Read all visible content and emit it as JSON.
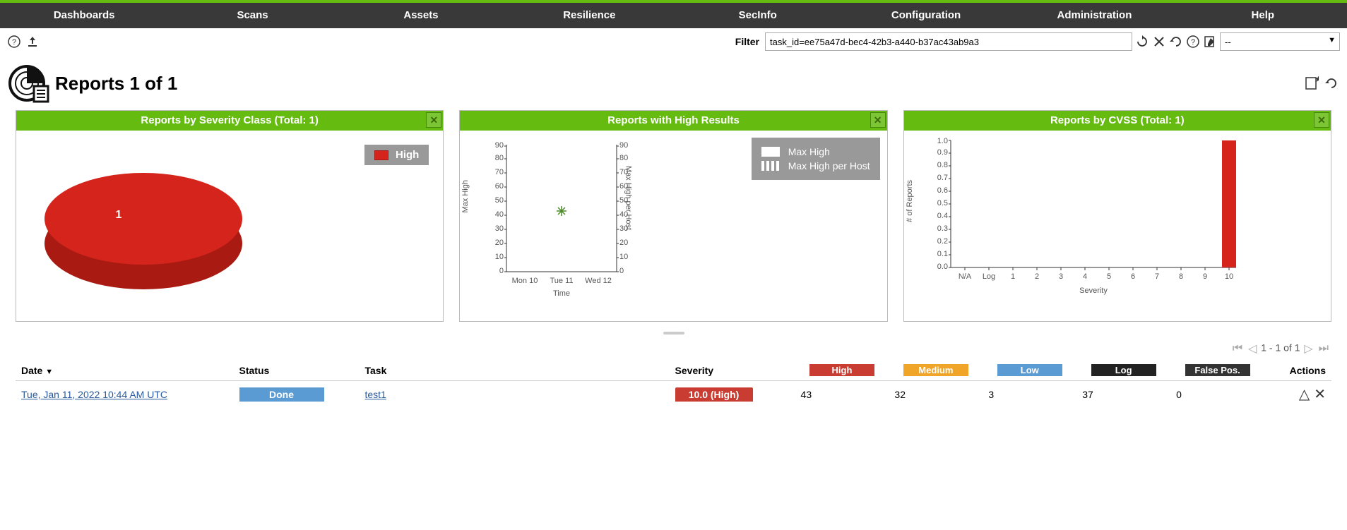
{
  "nav": [
    "Dashboards",
    "Scans",
    "Assets",
    "Resilience",
    "SecInfo",
    "Configuration",
    "Administration",
    "Help"
  ],
  "filter": {
    "label": "Filter",
    "value": "task_id=ee75a47d-bec4-42b3-a440-b37ac43ab9a3",
    "select_value": "--"
  },
  "page_title": "Reports 1 of 1",
  "panels": {
    "severity_class": {
      "title": "Reports by Severity Class (Total: 1)",
      "legend": "High",
      "slice_label": "1"
    },
    "high_results": {
      "title": "Reports with High Results",
      "legend1": "Max High",
      "legend2": "Max High per Host",
      "ylabel_left": "Max High",
      "ylabel_right": "Max High per Host",
      "xlabel": "Time"
    },
    "cvss": {
      "title": "Reports by CVSS (Total: 1)",
      "ylabel": "# of Reports",
      "xlabel": "Severity"
    }
  },
  "chart_data": [
    {
      "type": "pie",
      "title": "Reports by Severity Class (Total: 1)",
      "series": [
        {
          "name": "High",
          "value": 1,
          "color": "#d4241b"
        }
      ]
    },
    {
      "type": "scatter",
      "title": "Reports with High Results",
      "xlabel": "Time",
      "ylabel_left": "Max High",
      "ylabel_right": "Max High per Host",
      "x_ticks": [
        "Mon 10",
        "Tue 11",
        "Wed 12"
      ],
      "y_ticks": [
        0,
        10,
        20,
        30,
        40,
        50,
        60,
        70,
        80,
        90
      ],
      "ylim": [
        0,
        90
      ],
      "series": [
        {
          "name": "Max High",
          "style": "solid",
          "points": [
            {
              "x": "Tue 11",
              "y": 43
            }
          ]
        },
        {
          "name": "Max High per Host",
          "style": "dashed",
          "points": [
            {
              "x": "Tue 11",
              "y": 43
            }
          ]
        }
      ]
    },
    {
      "type": "bar",
      "title": "Reports by CVSS (Total: 1)",
      "xlabel": "Severity",
      "ylabel": "# of Reports",
      "categories": [
        "N/A",
        "Log",
        "1",
        "2",
        "3",
        "4",
        "5",
        "6",
        "7",
        "8",
        "9",
        "10"
      ],
      "values": [
        0,
        0,
        0,
        0,
        0,
        0,
        0,
        0,
        0,
        0,
        0,
        1
      ],
      "ylim": [
        0,
        1.0
      ],
      "y_ticks": [
        0.0,
        0.1,
        0.2,
        0.3,
        0.4,
        0.5,
        0.6,
        0.7,
        0.8,
        0.9,
        1.0
      ],
      "bar_color": "#d4241b"
    }
  ],
  "pager": {
    "range": "1 - 1 of 1"
  },
  "table": {
    "headers": {
      "date": "Date",
      "status": "Status",
      "task": "Task",
      "severity": "Severity",
      "high": "High",
      "medium": "Medium",
      "low": "Low",
      "log": "Log",
      "false_pos": "False Pos.",
      "actions": "Actions"
    },
    "rows": [
      {
        "date": "Tue, Jan 11, 2022 10:44 AM UTC",
        "status": "Done",
        "task": "test1",
        "severity": "10.0 (High)",
        "high": "43",
        "medium": "32",
        "low": "3",
        "log": "37",
        "false_pos": "0"
      }
    ]
  }
}
